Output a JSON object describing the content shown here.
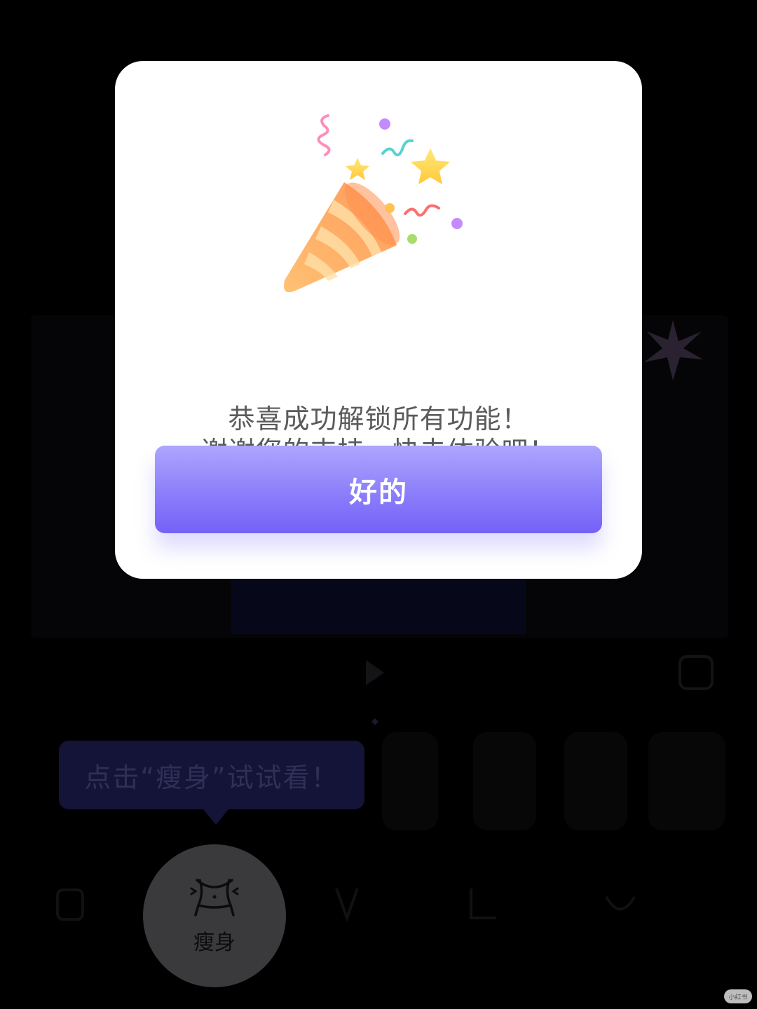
{
  "modal": {
    "message_line1": "恭喜成功解锁所有功能！",
    "message_line2": "谢谢您的支持，快去体验吧！",
    "ok_button_label": "好的",
    "icon": "party-popper-icon"
  },
  "hint": {
    "text": "点击“瘦身”试试看！"
  },
  "toolbar": {
    "slim_label": "瘦身",
    "slim_icon": "waist-icon"
  },
  "colors": {
    "accent": "#8b7efb",
    "overlay": "#000000",
    "message_text": "#5b5b5b",
    "hint_bubble": "#131437"
  }
}
